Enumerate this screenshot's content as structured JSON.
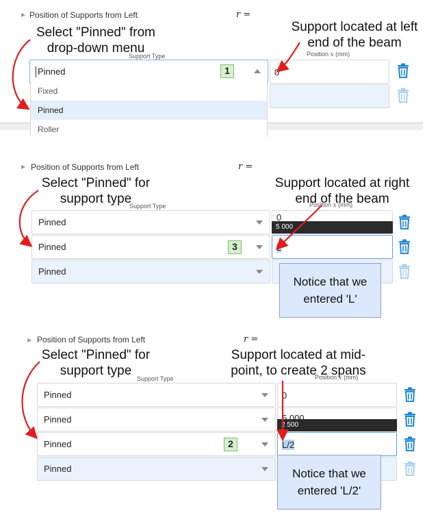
{
  "colors": {
    "trash_active": "#1f86d6",
    "trash_disabled": "#a8d0f0",
    "annotation_arrow": "#e11d1d",
    "badge_bg": "#d6f0cf",
    "note_bg": "#dce8fb"
  },
  "panels": [
    {
      "header": {
        "title": "Position of Supports from Left",
        "r_label": "r ="
      },
      "annotation_left": [
        "Select \"Pinned\" from",
        "drop-down menu"
      ],
      "annotation_right": [
        "Support located at left",
        "end of the beam"
      ],
      "support_type_label": "Support Type",
      "position_label_prefix": "Position ",
      "position_label_var": "x",
      "position_label_unit": " (mm)",
      "rows": [
        {
          "type": "Pinned",
          "position": "0",
          "badge": "1"
        },
        {
          "type": "",
          "position": ""
        }
      ],
      "dropdown_options": [
        "Fixed",
        "Pinned",
        "Roller"
      ],
      "dropdown_selected": "Pinned"
    },
    {
      "header": {
        "title": "Position of Supports from Left",
        "r_label": "r ="
      },
      "annotation_left": [
        "Select \"Pinned\" for",
        "support type"
      ],
      "annotation_right": [
        "Support located at right",
        "end of the beam"
      ],
      "support_type_label": "Support Type",
      "position_label_prefix": "Position ",
      "position_label_var": "x",
      "position_label_unit": " (mm)",
      "rows": [
        {
          "type": "Pinned",
          "position": "0"
        },
        {
          "type": "Pinned",
          "position": "L",
          "badge": "3"
        },
        {
          "type": "Pinned",
          "position": ""
        }
      ],
      "tooltip": "5 000",
      "note": [
        "Notice that we",
        "entered 'L'"
      ]
    },
    {
      "header": {
        "title": "Position of Supports from Left",
        "r_label": "r ="
      },
      "annotation_left": [
        "Select \"Pinned\" for",
        "support type"
      ],
      "annotation_right": [
        "Support located at mid-",
        "point, to create 2 spans"
      ],
      "support_type_label": "Support Type",
      "position_label_prefix": "Position ",
      "position_label_var": "x",
      "position_label_unit": " (mm)",
      "rows": [
        {
          "type": "Pinned",
          "position": "0"
        },
        {
          "type": "Pinned",
          "position": "5 000"
        },
        {
          "type": "Pinned",
          "position": "L/2",
          "badge": "2"
        },
        {
          "type": "Pinned",
          "position": ""
        }
      ],
      "tooltip": "2 500",
      "note": [
        "Notice that we",
        "entered 'L/2'"
      ]
    }
  ]
}
